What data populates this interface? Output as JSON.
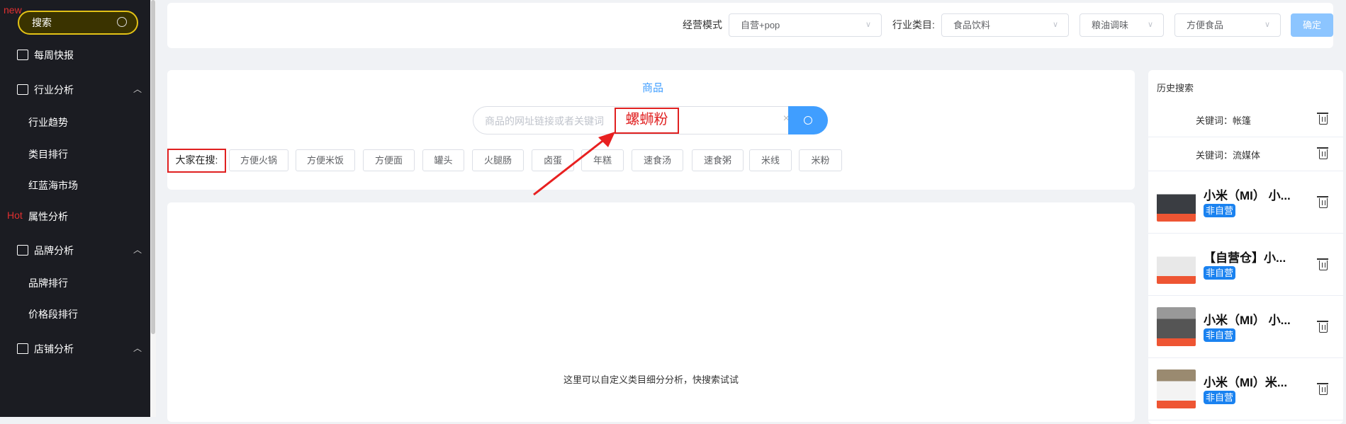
{
  "sidebar": {
    "new_badge": "new",
    "hot_badge": "Hot",
    "search_label": "搜索",
    "items": [
      {
        "label": "每周快报"
      },
      {
        "label": "行业分析"
      },
      {
        "label": "行业趋势"
      },
      {
        "label": "类目排行"
      },
      {
        "label": "红蓝海市场"
      },
      {
        "label": "属性分析"
      },
      {
        "label": "品牌分析"
      },
      {
        "label": "品牌排行"
      },
      {
        "label": "价格段排行"
      },
      {
        "label": "店铺分析"
      }
    ]
  },
  "filter": {
    "mode_label": "经营模式",
    "mode_value": "自营+pop",
    "category_label": "行业类目:",
    "category_1": "食品饮料",
    "category_2": "粮油调味",
    "category_3": "方便食品",
    "confirm": "确定"
  },
  "search": {
    "tab": "商品",
    "placeholder": "商品的网址链接或者关键词",
    "value": "螺蛳粉",
    "clear": "×",
    "hot_label": "大家在搜:",
    "tags": [
      "方便火锅",
      "方便米饭",
      "方便面",
      "罐头",
      "火腿肠",
      "卤蛋",
      "年糕",
      "速食汤",
      "速食粥",
      "米线",
      "米粉"
    ]
  },
  "result": {
    "empty_text": "这里可以自定义类目细分分析，快搜索试试"
  },
  "history": {
    "title": "历史搜索",
    "keywords": [
      "关键词：帐篷",
      "关键词：流媒体"
    ],
    "products": [
      {
        "title": "小米（MI） 小...",
        "badge": "非自营"
      },
      {
        "title": "【自营仓】小...",
        "badge": "非自营"
      },
      {
        "title": "小米（MI） 小...",
        "badge": "非自营"
      },
      {
        "title": "小米（MI）米...",
        "badge": "非自营"
      }
    ]
  }
}
